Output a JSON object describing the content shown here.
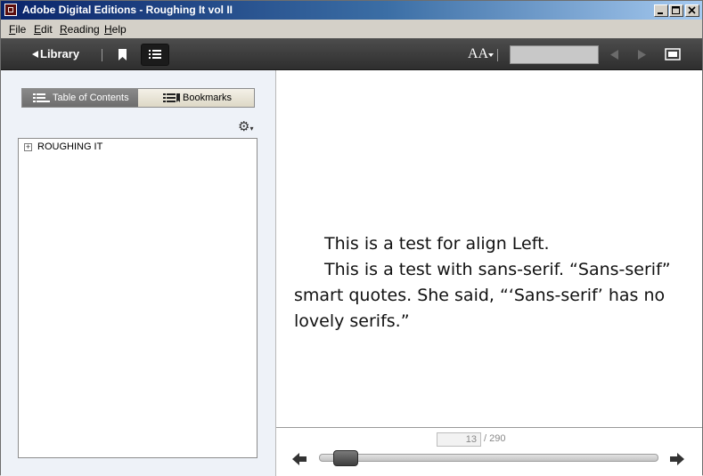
{
  "window": {
    "title": "Adobe Digital Editions - Roughing It vol II",
    "controls": {
      "minimize": "_",
      "maximize": "□",
      "close": "✕"
    }
  },
  "menu": [
    {
      "label": "File",
      "key": "F",
      "rest": "ile"
    },
    {
      "label": "Edit",
      "key": "E",
      "rest": "dit"
    },
    {
      "label": "Reading",
      "key": "R",
      "rest": "eading"
    },
    {
      "label": "Help",
      "key": "H",
      "rest": "elp"
    }
  ],
  "toolbar": {
    "library_label": "Library",
    "font_label": "AA",
    "icons": [
      "back-triangle-icon",
      "bookmark-icon",
      "list-icon",
      "font-size-icon",
      "prev-page-icon",
      "next-page-icon",
      "fullscreen-icon"
    ]
  },
  "sidebar": {
    "tabs": [
      {
        "label": "Table of Contents",
        "active": true
      },
      {
        "label": "Bookmarks",
        "active": false
      }
    ],
    "toc": [
      {
        "label": "ROUGHING IT",
        "expanded": false
      }
    ]
  },
  "reader": {
    "paragraphs": [
      "This is a test for align Left.",
      "This is a test with sans-serif. “Sans-serif” smart quotes. She said, “‘Sans-serif’ has no lovely serifs.”"
    ]
  },
  "navigation": {
    "current_page": "13",
    "total_pages": "/ 290",
    "progress": 0.045
  },
  "colors": {
    "title_start": "#0a246a",
    "title_end": "#a6caf0",
    "toolbar": "#3a3a3a"
  }
}
